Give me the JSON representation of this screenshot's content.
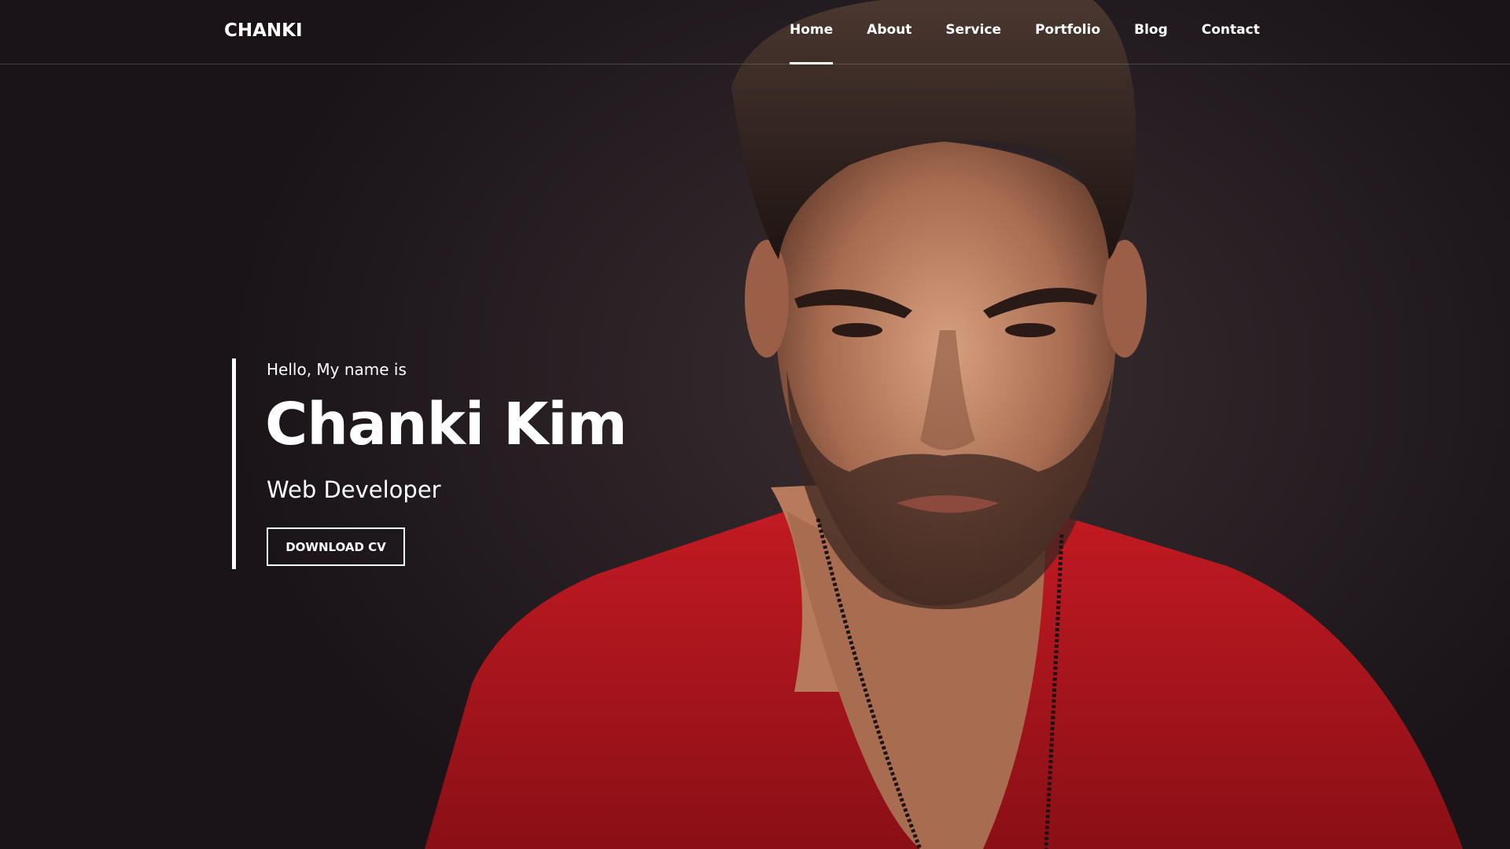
{
  "header": {
    "logo": "CHANKI",
    "nav": [
      {
        "label": "Home",
        "active": true
      },
      {
        "label": "About",
        "active": false
      },
      {
        "label": "Service",
        "active": false
      },
      {
        "label": "Portfolio",
        "active": false
      },
      {
        "label": "Blog",
        "active": false
      },
      {
        "label": "Contact",
        "active": false
      }
    ]
  },
  "hero": {
    "greeting": "Hello, My name is",
    "name": "Chanki Kim",
    "role": "Web Developer",
    "cta_label": "DOWNLOAD CV"
  },
  "colors": {
    "background": "#241c20",
    "shirt": "#b0141c",
    "text": "#ffffff"
  }
}
